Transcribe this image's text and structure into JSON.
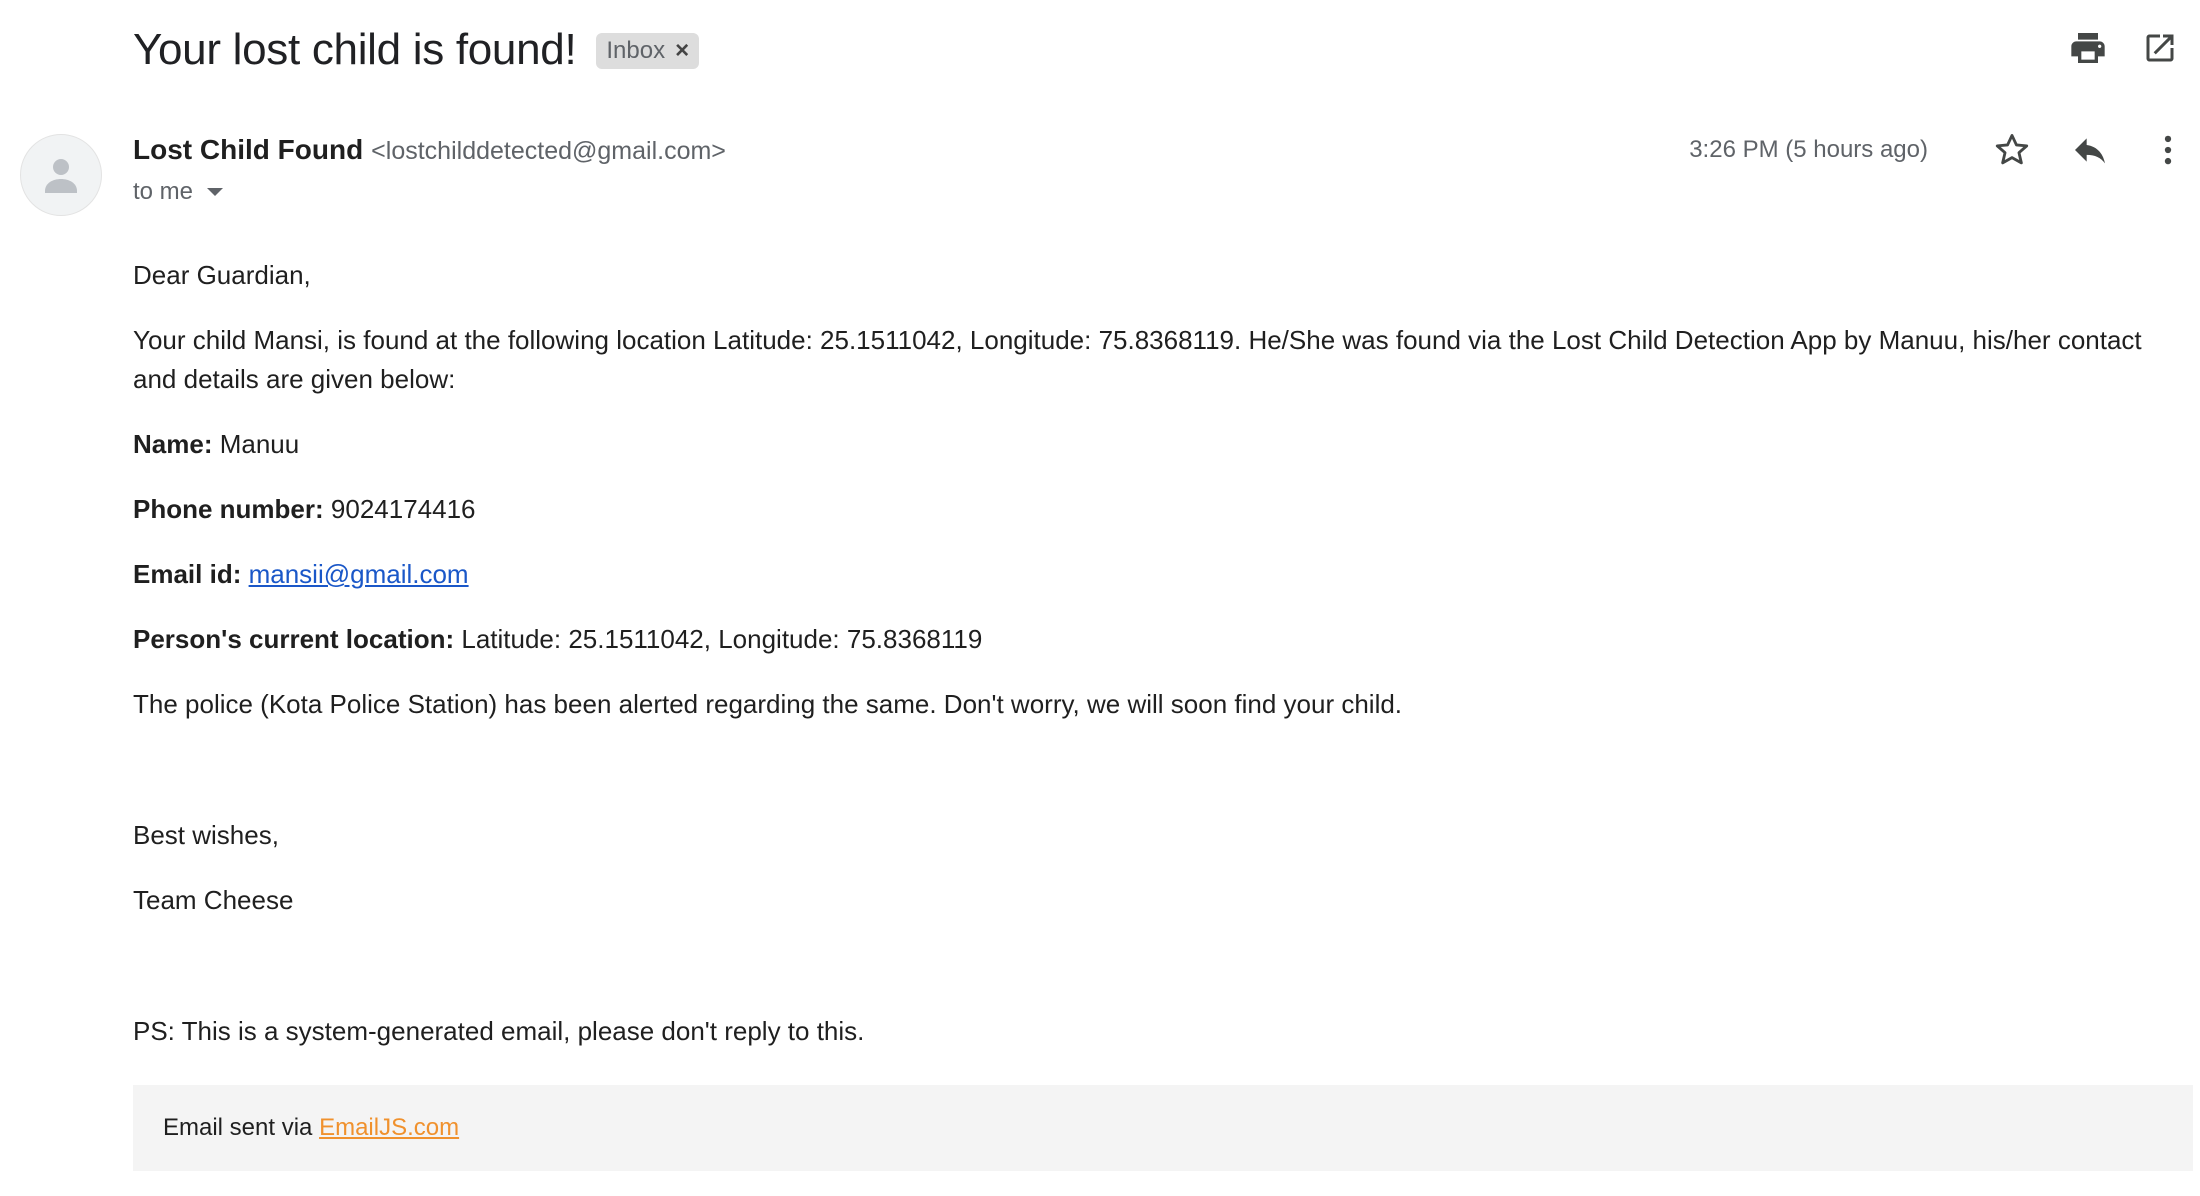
{
  "email": {
    "subject": "Your lost child is found!",
    "label": "Inbox",
    "label_remove_glyph": "×",
    "sender_name": "Lost Child Found",
    "sender_email": "<lostchilddetected@gmail.com>",
    "recipient": "to me",
    "timestamp": "3:26 PM (5 hours ago)"
  },
  "icons": {
    "print": "print-icon",
    "open_new_window": "open-in-new-window-icon",
    "star": "star-icon",
    "reply": "reply-icon",
    "more": "more-vert-icon",
    "avatar": "person-icon",
    "recipient_caret": "chevron-down-icon"
  },
  "body": {
    "greeting": "Dear Guardian,",
    "intro": "Your child Mansi, is found at the following location Latitude: 25.1511042, Longitude: 75.8368119. He/She was found via the Lost Child Detection App by Manuu, his/her contact and details are given below:",
    "name_label": "Name:",
    "name_value": " Manuu",
    "phone_label": "Phone number:",
    "phone_value": " 9024174416",
    "email_label": "Email id:",
    "email_value": "mansii@gmail.com",
    "location_label": "Person's current location:",
    "location_value": " Latitude: 25.1511042, Longitude: 75.8368119",
    "police_note": "The police (Kota Police Station) has been alerted regarding the same. Don't worry, we will soon find your child.",
    "closing": "Best wishes,",
    "signature": "Team Cheese",
    "ps": "PS: This is a system-generated email, please don't reply to this."
  },
  "footer": {
    "prefix": "Email sent via ",
    "link_text": "EmailJS.com"
  },
  "colors": {
    "link_blue": "#1a57c8",
    "footer_link_orange": "#f0912d",
    "icon_dark": "#444746",
    "footer_bg": "#f4f4f4",
    "chip_bg": "#dddddd"
  }
}
